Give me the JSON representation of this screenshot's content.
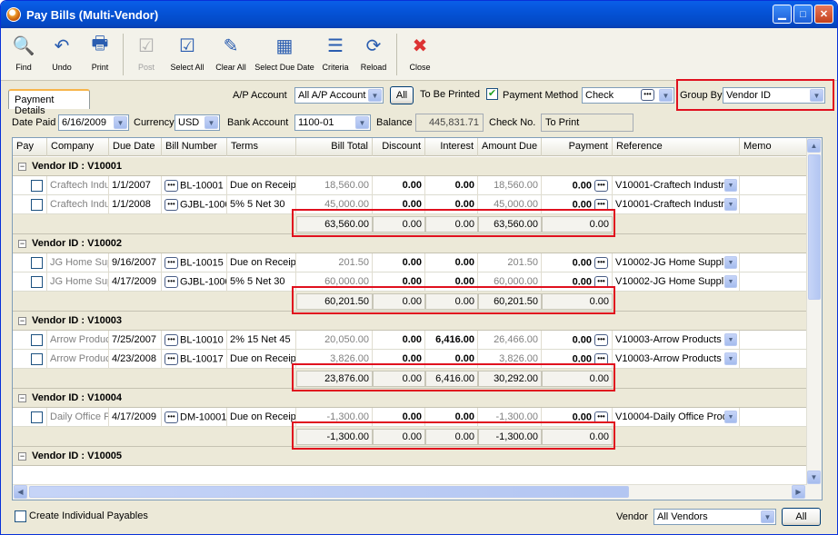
{
  "window": {
    "title": "Pay Bills (Multi-Vendor)"
  },
  "toolbar": [
    {
      "label": "Find",
      "icon": "binoculars-icon",
      "enabled": true
    },
    {
      "label": "Undo",
      "icon": "undo-icon",
      "enabled": true
    },
    {
      "label": "Print",
      "icon": "printer-icon",
      "enabled": true
    },
    {
      "label": "Post",
      "icon": "post-icon",
      "enabled": false
    },
    {
      "label": "Select All",
      "icon": "select-all-icon",
      "enabled": true
    },
    {
      "label": "Clear All",
      "icon": "clear-all-icon",
      "enabled": true
    },
    {
      "label": "Select Due Date",
      "icon": "calendar-icon",
      "enabled": true
    },
    {
      "label": "Criteria",
      "icon": "criteria-icon",
      "enabled": true
    },
    {
      "label": "Reload",
      "icon": "reload-icon",
      "enabled": true
    },
    {
      "label": "Close",
      "icon": "close-icon",
      "enabled": true
    }
  ],
  "tab": {
    "label": "Payment Details"
  },
  "header": {
    "ap_account_label": "A/P Account",
    "ap_account_value": "All A/P Account",
    "all_button": "All",
    "to_be_printed_label": "To Be Printed",
    "to_be_printed_checked": "✔",
    "payment_method_label": "Payment Method",
    "payment_method_value": "Check",
    "group_by_label": "Group By",
    "group_by_value": "Vendor ID",
    "date_paid_label": "Date Paid",
    "date_paid_value": "6/16/2009",
    "currency_label": "Currency",
    "currency_value": "USD",
    "bank_account_label": "Bank Account",
    "bank_account_value": "1100-01",
    "balance_label": "Balance",
    "balance_value": "445,831.71",
    "check_no_label": "Check No.",
    "check_no_value": "To Print"
  },
  "columns": [
    "Pay",
    "Company",
    "Due Date",
    "Bill Number",
    "Terms",
    "Bill Total",
    "Discount",
    "Interest",
    "Amount Due",
    "Payment",
    "Reference",
    "Memo"
  ],
  "groups": [
    {
      "title": "Vendor ID : V10001",
      "rows": [
        {
          "company": "Craftech Indu",
          "due_date": "1/1/2007",
          "bill_number": "BL-10001",
          "terms": "Due on Receipt",
          "bill_total": "18,560.00",
          "discount": "0.00",
          "interest": "0.00",
          "amount_due": "18,560.00",
          "payment": "0.00",
          "reference": "V10001-Craftech Industr"
        },
        {
          "company": "Craftech Indu",
          "due_date": "1/1/2008",
          "bill_number": "GJBL-1000",
          "terms": "5% 5 Net 30",
          "bill_total": "45,000.00",
          "discount": "0.00",
          "interest": "0.00",
          "amount_due": "45,000.00",
          "payment": "0.00",
          "reference": "V10001-Craftech Industr"
        }
      ],
      "subtotal": {
        "bill_total": "63,560.00",
        "discount": "0.00",
        "interest": "0.00",
        "amount_due": "63,560.00",
        "payment": "0.00"
      }
    },
    {
      "title": "Vendor ID : V10002",
      "rows": [
        {
          "company": "JG Home Supp",
          "due_date": "9/16/2007",
          "bill_number": "BL-10015",
          "terms": "Due on Receipt",
          "bill_total": "201.50",
          "discount": "0.00",
          "interest": "0.00",
          "amount_due": "201.50",
          "payment": "0.00",
          "reference": "V10002-JG Home Supplie"
        },
        {
          "company": "JG Home Supp",
          "due_date": "4/17/2009",
          "bill_number": "GJBL-1000",
          "terms": "5% 5 Net 30",
          "bill_total": "60,000.00",
          "discount": "0.00",
          "interest": "0.00",
          "amount_due": "60,000.00",
          "payment": "0.00",
          "reference": "V10002-JG Home Supplie"
        }
      ],
      "subtotal": {
        "bill_total": "60,201.50",
        "discount": "0.00",
        "interest": "0.00",
        "amount_due": "60,201.50",
        "payment": "0.00"
      }
    },
    {
      "title": "Vendor ID : V10003",
      "rows": [
        {
          "company": "Arrow Produc",
          "due_date": "7/25/2007",
          "bill_number": "BL-10010",
          "terms": "2% 15 Net 45",
          "bill_total": "20,050.00",
          "discount": "0.00",
          "interest": "6,416.00",
          "amount_due": "26,466.00",
          "payment": "0.00",
          "reference": "V10003-Arrow Products ("
        },
        {
          "company": "Arrow Produc",
          "due_date": "4/23/2008",
          "bill_number": "BL-10017",
          "terms": "Due on Receipt",
          "bill_total": "3,826.00",
          "discount": "0.00",
          "interest": "0.00",
          "amount_due": "3,826.00",
          "payment": "0.00",
          "reference": "V10003-Arrow Products ("
        }
      ],
      "subtotal": {
        "bill_total": "23,876.00",
        "discount": "0.00",
        "interest": "6,416.00",
        "amount_due": "30,292.00",
        "payment": "0.00"
      }
    },
    {
      "title": "Vendor ID : V10004",
      "rows": [
        {
          "company": "Daily Office P",
          "due_date": "4/17/2009",
          "bill_number": "DM-10001",
          "terms": "Due on Receipt",
          "bill_total": "-1,300.00",
          "discount": "0.00",
          "interest": "0.00",
          "amount_due": "-1,300.00",
          "payment": "0.00",
          "reference": "V10004-Daily Office Prod"
        }
      ],
      "subtotal": {
        "bill_total": "-1,300.00",
        "discount": "0.00",
        "interest": "0.00",
        "amount_due": "-1,300.00",
        "payment": "0.00"
      }
    },
    {
      "title": "Vendor ID : V10005",
      "rows": [],
      "subtotal": null
    }
  ],
  "footer": {
    "create_individual_label": "Create Individual Payables",
    "vendor_label": "Vendor",
    "vendor_value": "All Vendors",
    "all_button": "All"
  },
  "colors": {
    "titlebar": "#0553d7",
    "highlight": "#e0101e",
    "chrome": "#ece9d8"
  }
}
